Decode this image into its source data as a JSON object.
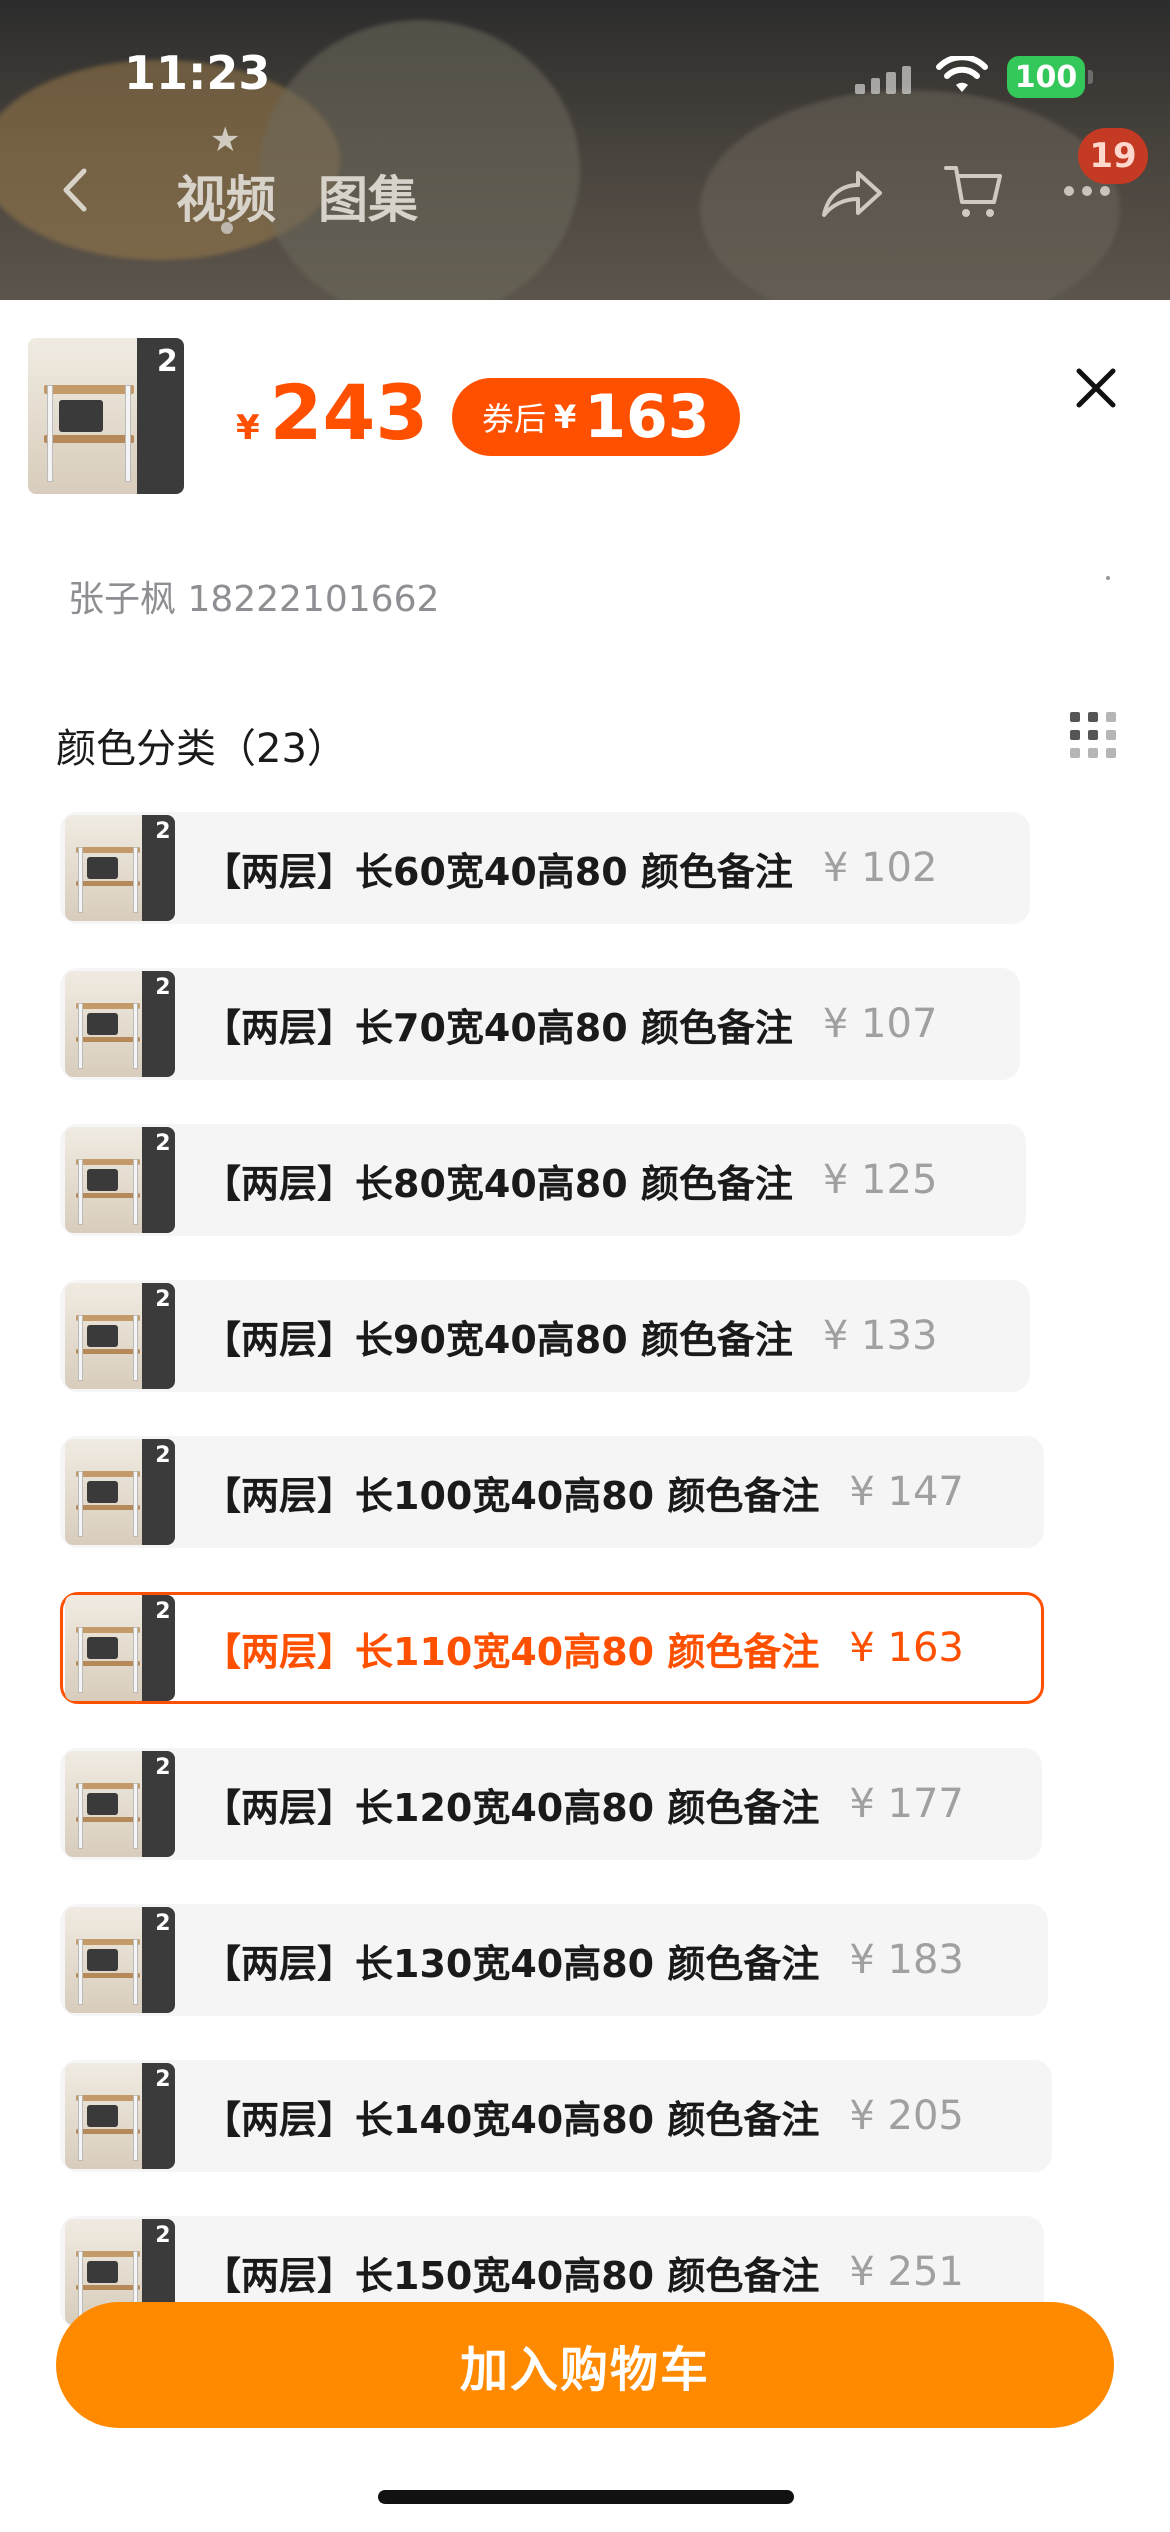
{
  "status_bar": {
    "time": "11:23",
    "battery": "100"
  },
  "top_nav": {
    "tabs": [
      "视频",
      "图集"
    ],
    "cart_badge": "19"
  },
  "header": {
    "price_symbol": "¥",
    "price": "243",
    "coupon_label": "券后",
    "coupon_symbol": "¥",
    "coupon_price": "163",
    "thumb_number": "2"
  },
  "address": "张子枫 18222101662",
  "section": {
    "title": "颜色分类（23）"
  },
  "options": [
    {
      "label": "【两层】长60宽40高80 颜色备注",
      "price": "¥ 102",
      "selected": false
    },
    {
      "label": "【两层】长70宽40高80 颜色备注",
      "price": "¥ 107",
      "selected": false
    },
    {
      "label": "【两层】长80宽40高80 颜色备注",
      "price": "¥ 125",
      "selected": false
    },
    {
      "label": "【两层】长90宽40高80 颜色备注",
      "price": "¥ 133",
      "selected": false
    },
    {
      "label": "【两层】长100宽40高80 颜色备注",
      "price": "¥ 147",
      "selected": false
    },
    {
      "label": "【两层】长110宽40高80 颜色备注",
      "price": "¥ 163",
      "selected": true
    },
    {
      "label": "【两层】长120宽40高80 颜色备注",
      "price": "¥ 177",
      "selected": false
    },
    {
      "label": "【两层】长130宽40高80 颜色备注",
      "price": "¥ 183",
      "selected": false
    },
    {
      "label": "【两层】长140宽40高80 颜色备注",
      "price": "¥ 205",
      "selected": false
    },
    {
      "label": "【两层】长150宽40高80 颜色备注",
      "price": "¥ 251",
      "selected": false
    }
  ],
  "cta": {
    "label": "加入购物车"
  },
  "colors": {
    "accent": "#ff5000",
    "cta": "#ff8a00",
    "option_bg": "#f5f5f5"
  }
}
